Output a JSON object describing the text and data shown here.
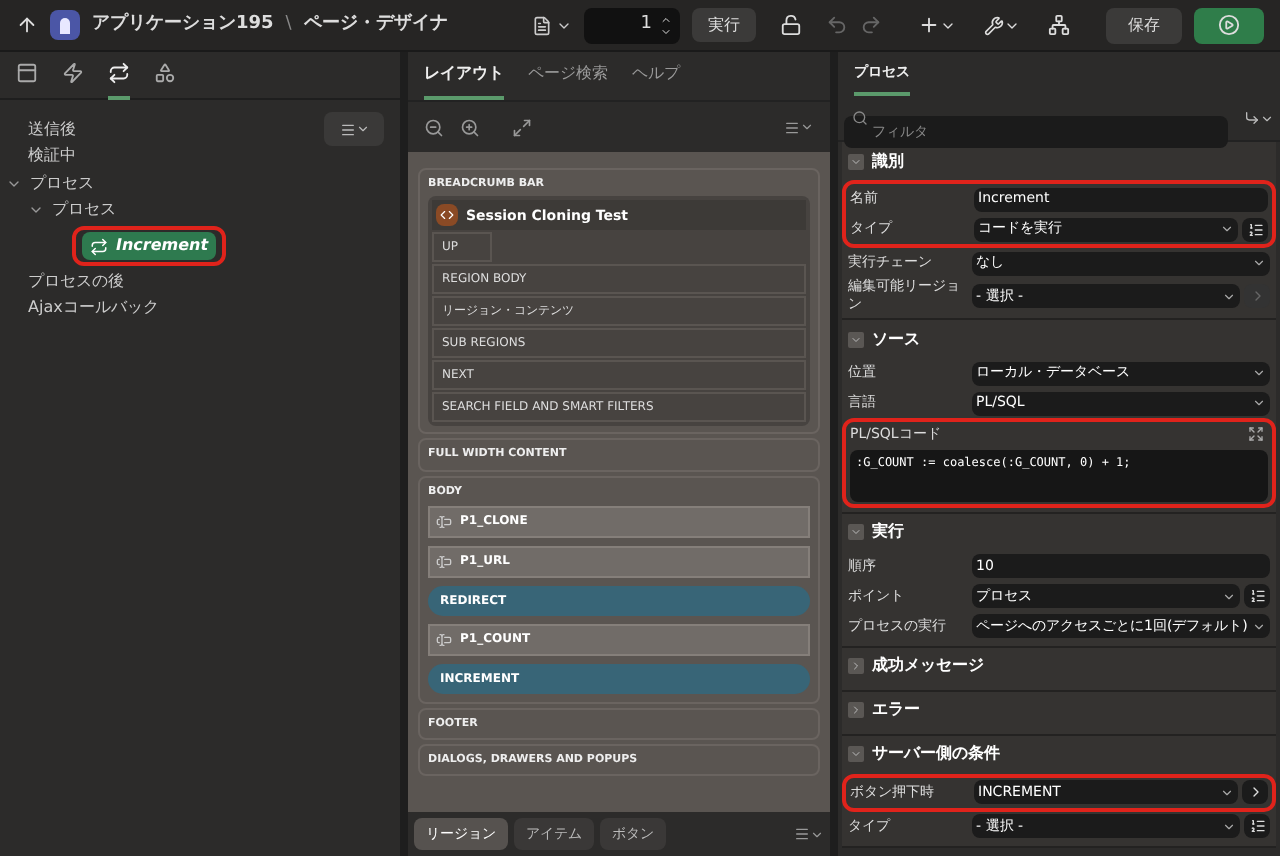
{
  "header": {
    "app": "アプリケーション195",
    "separator": "\\",
    "page_title": "ページ・デザイナ",
    "page_number": "1",
    "run_label": "実行",
    "save_label": "保存"
  },
  "left_panel": {
    "tabs": [
      {
        "kind": "rendering",
        "selected": false
      },
      {
        "kind": "dynamic_actions",
        "selected": false
      },
      {
        "kind": "processing",
        "selected": true
      },
      {
        "kind": "shared",
        "selected": false
      }
    ],
    "tree": [
      {
        "label": "送信後",
        "selected": false
      },
      {
        "label": "検証中",
        "selected": false
      },
      {
        "label": "プロセス",
        "selected": false,
        "expanded": true,
        "children": [
          {
            "label": "プロセス",
            "selected": false,
            "expanded": true,
            "children": [
              {
                "label": "Increment",
                "selected": true,
                "highlighted": true
              }
            ]
          }
        ]
      },
      {
        "label": "プロセスの後",
        "selected": false
      },
      {
        "label": "Ajaxコールバック",
        "selected": false
      }
    ]
  },
  "layout_panel": {
    "tabs": [
      {
        "label": "レイアウト",
        "selected": true
      },
      {
        "label": "ページ検索",
        "selected": false
      },
      {
        "label": "ヘルプ",
        "selected": false
      }
    ],
    "sections": [
      {
        "title": "BREADCRUMB BAR",
        "regions": [
          {
            "title": "Session Cloning Test",
            "slots": [
              "UP",
              "REGION BODY",
              "リージョン・コンテンツ",
              "SUB REGIONS",
              "NEXT",
              "SEARCH FIELD AND SMART FILTERS"
            ]
          }
        ]
      },
      {
        "title": "FULL WIDTH CONTENT"
      },
      {
        "title": "BODY",
        "components": [
          {
            "kind": "item",
            "label": "P1_CLONE"
          },
          {
            "kind": "item",
            "label": "P1_URL"
          },
          {
            "kind": "button",
            "label": "REDIRECT"
          },
          {
            "kind": "item",
            "label": "P1_COUNT"
          },
          {
            "kind": "button",
            "label": "INCREMENT"
          }
        ]
      },
      {
        "title": "FOOTER"
      },
      {
        "title": "DIALOGS, DRAWERS AND POPUPS"
      }
    ],
    "bottom_tabs": [
      {
        "label": "リージョン",
        "selected": true
      },
      {
        "label": "アイテム",
        "selected": false
      },
      {
        "label": "ボタン",
        "selected": false
      }
    ]
  },
  "property_panel": {
    "tabs": [
      {
        "label": "プロセス",
        "selected": true
      }
    ],
    "filter": {
      "placeholder": "フィルタ"
    },
    "sections": [
      {
        "title": "識別",
        "expanded": true,
        "properties": [
          {
            "kind": "text",
            "label": "名前",
            "value": "Increment",
            "highlighted": true
          },
          {
            "kind": "select",
            "label": "タイプ",
            "value": "コードを実行",
            "highlighted": true,
            "action": {
              "kind": "list",
              "disabled": false
            }
          },
          {
            "kind": "select",
            "label": "実行チェーン",
            "value": "なし"
          },
          {
            "kind": "select",
            "label": "編集可能リージョン",
            "value": "- 選択 -",
            "action": {
              "kind": "link",
              "disabled": true
            }
          }
        ]
      },
      {
        "title": "ソース",
        "expanded": true,
        "properties": [
          {
            "kind": "select",
            "label": "位置",
            "value": "ローカル・データベース"
          },
          {
            "kind": "select",
            "label": "言語",
            "value": "PL/SQL"
          },
          {
            "kind": "code",
            "label": "PL/SQLコード",
            "value": ":G_COUNT := coalesce(:G_COUNT, 0) + 1;",
            "highlighted": true
          }
        ]
      },
      {
        "title": "実行",
        "expanded": true,
        "properties": [
          {
            "kind": "text",
            "label": "順序",
            "value": "10"
          },
          {
            "kind": "select",
            "label": "ポイント",
            "value": "プロセス",
            "action": {
              "kind": "list",
              "disabled": false
            }
          },
          {
            "kind": "select",
            "label": "プロセスの実行",
            "value": "ページへのアクセスごとに1回(デフォルト)"
          }
        ]
      },
      {
        "title": "成功メッセージ",
        "expanded": false
      },
      {
        "title": "エラー",
        "expanded": false
      },
      {
        "title": "サーバー側の条件",
        "expanded": true,
        "properties": [
          {
            "kind": "select",
            "label": "ボタン押下時",
            "value": "INCREMENT",
            "highlighted": true,
            "action": {
              "kind": "link",
              "disabled": false
            }
          },
          {
            "kind": "select",
            "label": "タイプ",
            "value": "- 選択 -",
            "action": {
              "kind": "list",
              "disabled": false
            }
          }
        ]
      }
    ]
  }
}
